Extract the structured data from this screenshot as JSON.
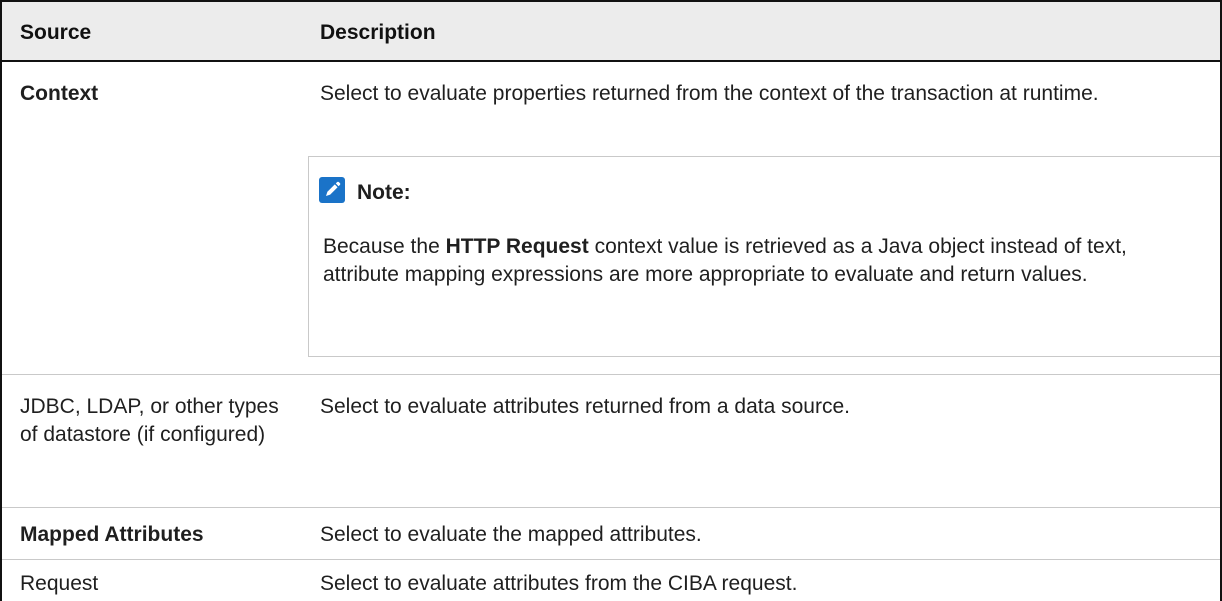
{
  "table": {
    "headers": {
      "source": "Source",
      "description": "Description"
    },
    "rows": [
      {
        "source": "Context",
        "description": "Select to evaluate properties returned from the context of the transaction at runtime.",
        "note": {
          "title": "Note:",
          "body_prefix": "Because the ",
          "body_bold": "HTTP Request",
          "body_suffix": " context value is retrieved as a Java object instead of text, attribute mapping expressions are more appropriate to evaluate and return values."
        }
      },
      {
        "source": "JDBC, LDAP, or other types of datastore (if configured)",
        "description": "Select to evaluate attributes returned from a data source."
      },
      {
        "source": "Mapped Attributes",
        "description": "Select to evaluate the mapped attributes."
      },
      {
        "source": "Request",
        "description": "Select to evaluate attributes from the CIBA request."
      }
    ]
  },
  "icons": {
    "note_icon": "pencil-note-icon"
  },
  "colors": {
    "header_background": "#ececec",
    "note_icon": "#1a73c8"
  }
}
